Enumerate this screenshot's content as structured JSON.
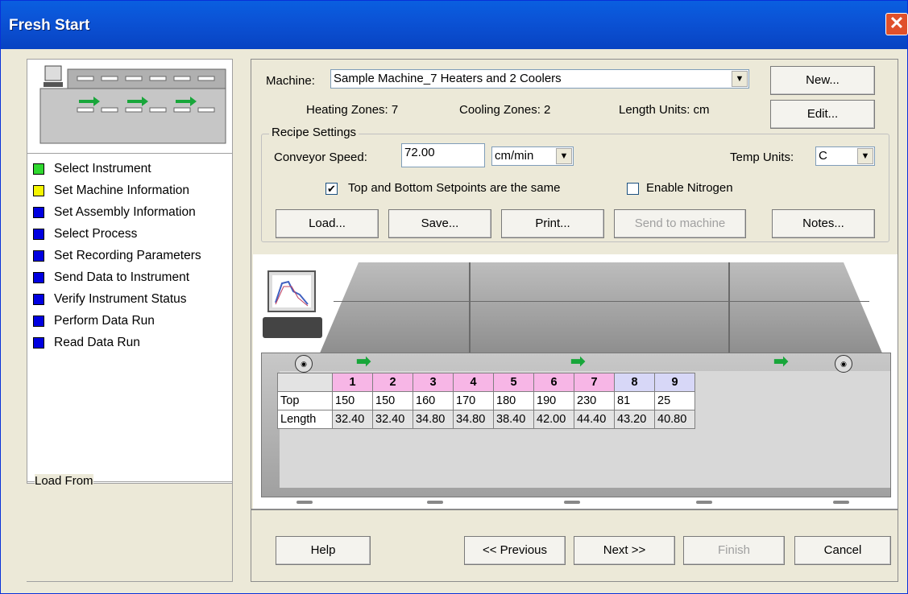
{
  "window": {
    "title": "Fresh Start",
    "close_glyph": "✕"
  },
  "steps": [
    {
      "label": "Select Instrument",
      "color": "#2fd82f"
    },
    {
      "label": "Set Machine Information",
      "color": "#f5f500"
    },
    {
      "label": "Set Assembly Information",
      "color": "#0000e0"
    },
    {
      "label": "Select Process",
      "color": "#0000e0"
    },
    {
      "label": "Set Recording Parameters",
      "color": "#0000e0"
    },
    {
      "label": "Send Data to Instrument",
      "color": "#0000e0"
    },
    {
      "label": "Verify Instrument Status",
      "color": "#0000e0"
    },
    {
      "label": "Perform Data Run",
      "color": "#0000e0"
    },
    {
      "label": "Read Data Run",
      "color": "#0000e0"
    }
  ],
  "load_from": {
    "label": "Load From"
  },
  "machine": {
    "label": "Machine:",
    "value": "Sample Machine_7 Heaters and 2 Coolers",
    "heating_zones": "Heating Zones: 7",
    "cooling_zones": "Cooling Zones: 2",
    "length_units": "Length Units: cm",
    "new_label": "New...",
    "edit_label": "Edit..."
  },
  "recipe": {
    "group_title": "Recipe Settings",
    "conveyor_label": "Conveyor Speed:",
    "conveyor_value": "72.00",
    "speed_unit": "cm/min",
    "temp_units_label": "Temp Units:",
    "temp_units_value": "C",
    "same_setpoints_label": "Top and Bottom Setpoints are the same",
    "same_setpoints_checked": "✔",
    "nitrogen_label": "Enable Nitrogen",
    "load": "Load...",
    "save": "Save...",
    "print": "Print...",
    "send": "Send to machine",
    "notes": "Notes..."
  },
  "zones": {
    "headers": [
      "1",
      "2",
      "3",
      "4",
      "5",
      "6",
      "7",
      "8",
      "9"
    ],
    "row_top_label": "Top",
    "top": [
      "150",
      "150",
      "160",
      "170",
      "180",
      "190",
      "230",
      "81",
      "25"
    ],
    "row_length_label": "Length",
    "length": [
      "32.40",
      "32.40",
      "34.80",
      "34.80",
      "38.40",
      "42.00",
      "44.40",
      "43.20",
      "40.80"
    ],
    "heat_color": "#f7b6e6",
    "cool_color": "#d7d7f7"
  },
  "nav": {
    "help": "Help",
    "previous": "<< Previous",
    "next": "Next >>",
    "finish": "Finish",
    "cancel": "Cancel"
  }
}
